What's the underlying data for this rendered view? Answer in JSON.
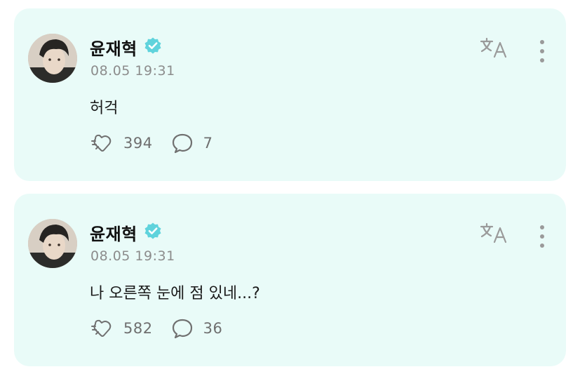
{
  "posts": [
    {
      "author": "윤재혁",
      "timestamp": "08.05 19:31",
      "text": "허걱",
      "likes": "394",
      "comments": "7"
    },
    {
      "author": "윤재혁",
      "timestamp": "08.05 19:31",
      "text": "나 오른쪽 눈에 점 있네...?",
      "likes": "582",
      "comments": "36"
    }
  ],
  "icons": {
    "verified": "verified-badge-icon",
    "translate": "translate-icon",
    "more": "more-vertical-icon",
    "like": "like-icon",
    "comment": "comment-bubble-icon"
  },
  "colors": {
    "card_background": "#e9fbf8",
    "verified": "#5fd3dc",
    "meta_text": "#8c8c8c"
  }
}
